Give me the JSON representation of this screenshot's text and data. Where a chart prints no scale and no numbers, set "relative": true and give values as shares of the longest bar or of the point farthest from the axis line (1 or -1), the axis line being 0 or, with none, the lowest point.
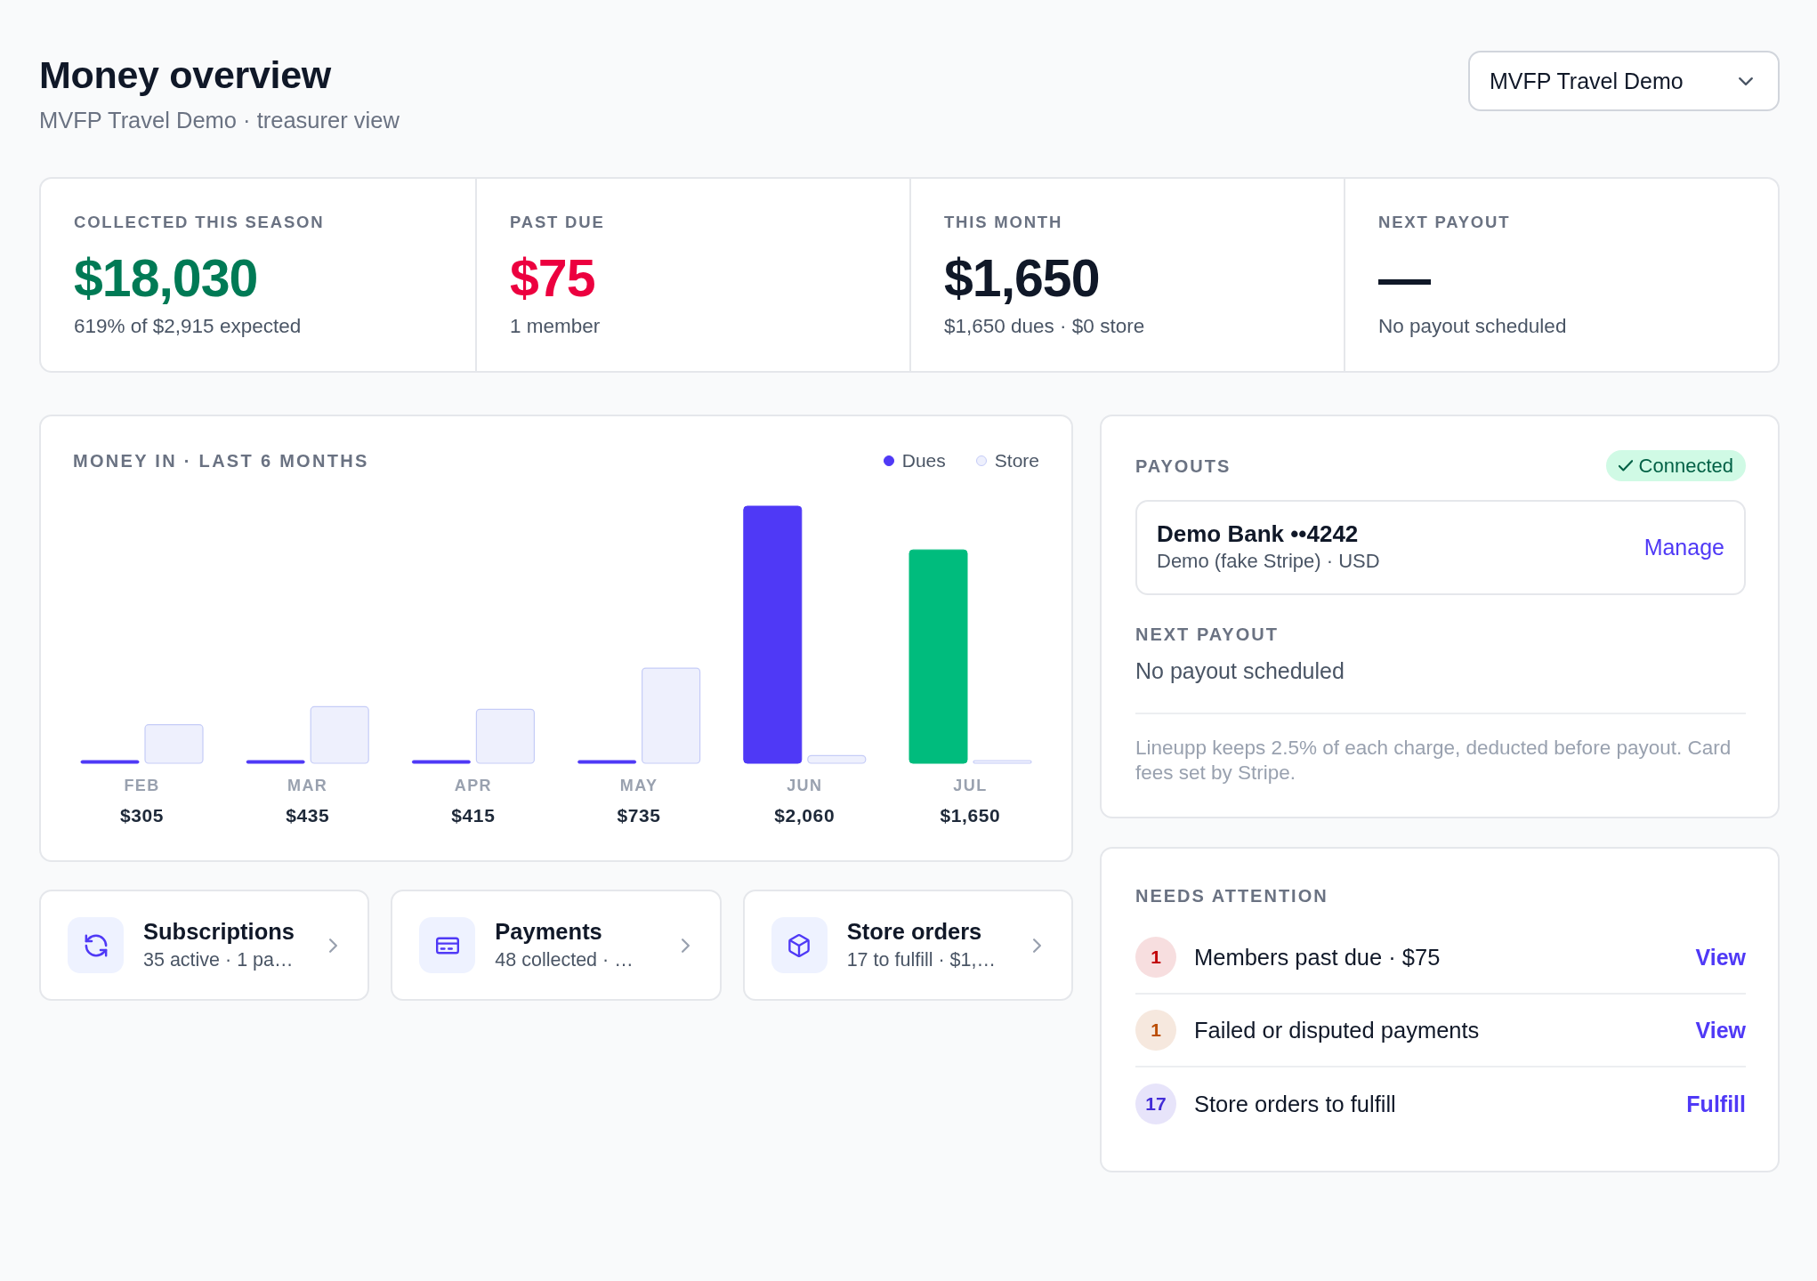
{
  "header": {
    "title": "Money overview",
    "subtitle": "MVFP Travel Demo · treasurer view",
    "org_select": {
      "value": "MVFP Travel Demo"
    }
  },
  "stats": [
    {
      "label": "COLLECTED THIS SEASON",
      "value": "$18,030",
      "color": "#007a55",
      "detail": "619% of $2,915 expected"
    },
    {
      "label": "PAST DUE",
      "value": "$75",
      "color": "#ec003f",
      "detail": "1 member"
    },
    {
      "label": "THIS MONTH",
      "value": "$1,650",
      "color": "#101828",
      "detail": "$1,650 dues · $0 store"
    },
    {
      "label": "NEXT PAYOUT",
      "value": "—",
      "color": "#101828",
      "detail": "No payout scheduled"
    }
  ],
  "money_in": {
    "title": "MONEY IN · LAST 6 MONTHS",
    "chart_data": {
      "type": "bar",
      "relative": true,
      "categories": [
        "FEB",
        "MAR",
        "APR",
        "MAY",
        "JUN",
        "JUL"
      ],
      "series": [
        {
          "name": "Dues",
          "color": "#4f39f6",
          "colors": [
            "#4f39f6",
            "#4f39f6",
            "#4f39f6",
            "#4f39f6",
            "#4f39f6",
            "#00bc7d"
          ],
          "values": [
            0,
            0,
            0,
            0,
            1,
            0.83
          ]
        },
        {
          "name": "Store",
          "color": "#eef0fd",
          "values": [
            0.15,
            0.22,
            0.21,
            0.37,
            0.03,
            0
          ]
        }
      ],
      "value_labels": [
        "$305",
        "$435",
        "$415",
        "$735",
        "$2,060",
        "$1,650"
      ]
    }
  },
  "shortcuts": [
    {
      "kind": "subscriptions",
      "title": "Subscriptions",
      "detail": "35 active · 1 pa…"
    },
    {
      "kind": "payments",
      "title": "Payments",
      "detail": "48 collected · …"
    },
    {
      "kind": "orders",
      "title": "Store orders",
      "detail": "17 to fulfill · $1,…"
    }
  ],
  "payouts": {
    "title": "PAYOUTS",
    "status": {
      "label": "Connected",
      "connected": true
    },
    "account": {
      "name": "Demo Bank ••4242",
      "detail": "Demo (fake Stripe) · USD",
      "action": "Manage"
    },
    "next_payout": {
      "label": "NEXT PAYOUT",
      "value": "No payout scheduled"
    },
    "note": "Lineupp keeps 2.5% of each charge, deducted before payout. Card fees set by Stripe."
  },
  "attention": {
    "title": "NEEDS ATTENTION",
    "items": [
      {
        "count": "1",
        "color": "#c10007",
        "text": "Members past due · $75",
        "action": "View"
      },
      {
        "count": "1",
        "color": "#bb4d00",
        "text": "Failed or disputed payments",
        "action": "View"
      },
      {
        "count": "17",
        "color": "#432dd7",
        "text": "Store orders to fulfill",
        "action": "Fulfill"
      }
    ]
  }
}
